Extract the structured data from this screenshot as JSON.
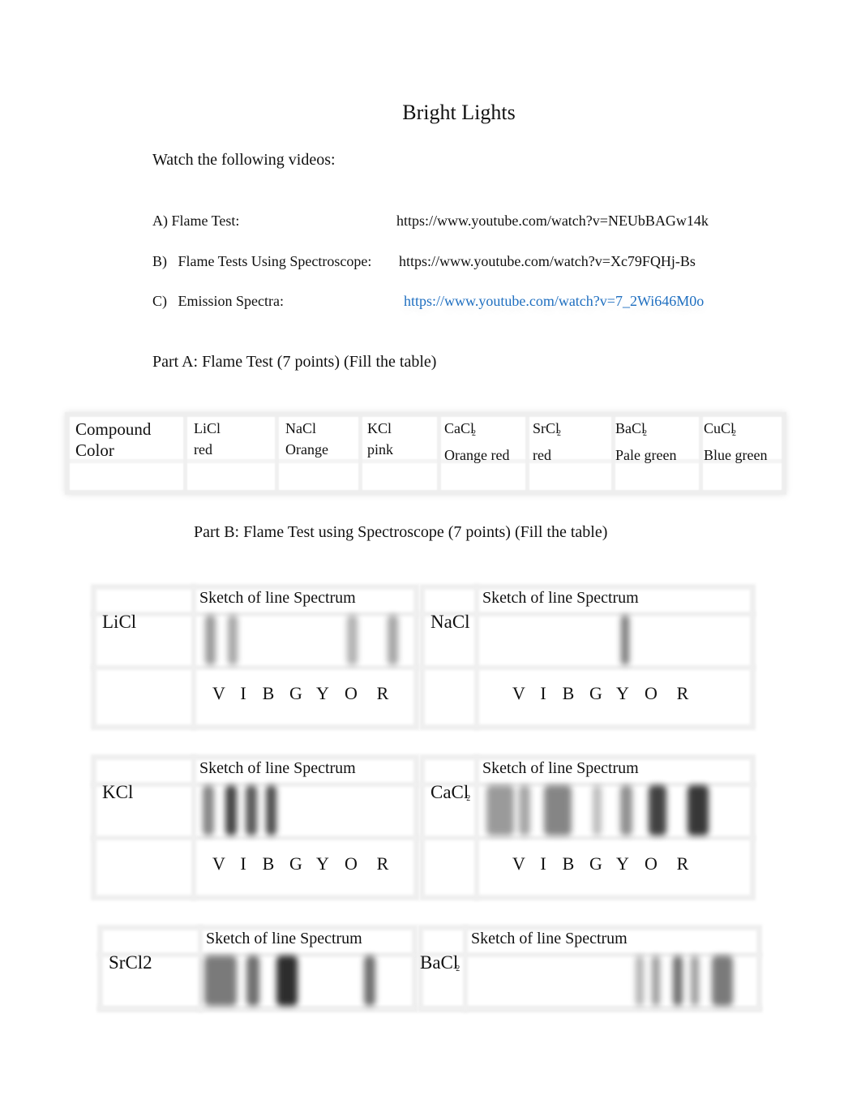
{
  "title": "Bright Lights",
  "intro": "Watch the following videos:",
  "videos": [
    {
      "label": "A) Flame Test:",
      "url": "https://www.youtube.com/watch?v=NEUbBAGw14k",
      "is_link": false
    },
    {
      "label": "B)   Flame Tests Using Spectroscope:",
      "url": "https://www.youtube.com/watch?v=Xc79FQHj-Bs",
      "is_link": false
    },
    {
      "label": "C)   Emission Spectra:",
      "url": "https://www.youtube.com/watch?v=7_2Wi646M0o",
      "is_link": true
    }
  ],
  "link_color": "#1f6fc0",
  "part_a": {
    "heading": "Part A: Flame Test (7 points) (Fill the table)",
    "header_cell": [
      "Compound",
      "Color"
    ],
    "columns": [
      {
        "compound": "LiCl",
        "sub": "",
        "color": "red"
      },
      {
        "compound": "NaCl",
        "sub": "",
        "color": "Orange"
      },
      {
        "compound": "KCl",
        "sub": "",
        "color": "pink"
      },
      {
        "compound": "CaCl",
        "sub": "2",
        "color": "Orange red"
      },
      {
        "compound": "SrCl",
        "sub": "2",
        "color": "red"
      },
      {
        "compound": "BaCl",
        "sub": "2",
        "color": "Pale green"
      },
      {
        "compound": "CuCl",
        "sub": "2",
        "color": "Blue green"
      }
    ]
  },
  "part_b": {
    "heading": "Part B:  Flame Test using Spectroscope (7 points) (Fill the table)",
    "sketch_label": "Sketch of line Spectrum",
    "scale_letters": [
      "V",
      "I",
      "B",
      "G",
      "Y",
      "O",
      "R"
    ],
    "spectra": [
      {
        "compound": "LiCl",
        "sub": "",
        "show_scale": true,
        "bands": [
          {
            "pos": 0.02,
            "width": 0.05,
            "darkness": 0.45
          },
          {
            "pos": 0.13,
            "width": 0.05,
            "darkness": 0.4
          },
          {
            "pos": 0.72,
            "width": 0.05,
            "darkness": 0.35
          },
          {
            "pos": 0.92,
            "width": 0.05,
            "darkness": 0.4
          }
        ]
      },
      {
        "compound": "NaCl",
        "sub": "",
        "show_scale": true,
        "bands": [
          {
            "pos": 0.6,
            "width": 0.05,
            "darkness": 0.6
          }
        ]
      },
      {
        "compound": "KCl",
        "sub": "",
        "show_scale": true,
        "bands": [
          {
            "pos": 0.0,
            "width": 0.09,
            "darkness": 0.55
          },
          {
            "pos": 0.18,
            "width": 0.09,
            "darkness": 0.85
          },
          {
            "pos": 0.34,
            "width": 0.09,
            "darkness": 0.75
          },
          {
            "pos": 0.5,
            "width": 0.09,
            "darkness": 0.8
          }
        ]
      },
      {
        "compound": "CaCl",
        "sub": "2",
        "show_scale": true,
        "bands": [
          {
            "pos": 0.0,
            "width": 0.12,
            "darkness": 0.45
          },
          {
            "pos": 0.14,
            "width": 0.05,
            "darkness": 0.4
          },
          {
            "pos": 0.25,
            "width": 0.12,
            "darkness": 0.55
          },
          {
            "pos": 0.46,
            "width": 0.04,
            "darkness": 0.3
          },
          {
            "pos": 0.58,
            "width": 0.05,
            "darkness": 0.5
          },
          {
            "pos": 0.7,
            "width": 0.08,
            "darkness": 0.85
          },
          {
            "pos": 0.87,
            "width": 0.09,
            "darkness": 0.9
          }
        ]
      },
      {
        "compound": "SrCl2",
        "sub": "",
        "show_scale": false,
        "bands": [
          {
            "pos": 0.0,
            "width": 0.17,
            "darkness": 0.6
          },
          {
            "pos": 0.22,
            "width": 0.07,
            "darkness": 0.65
          },
          {
            "pos": 0.38,
            "width": 0.11,
            "darkness": 0.95
          },
          {
            "pos": 0.84,
            "width": 0.06,
            "darkness": 0.65
          }
        ]
      },
      {
        "compound": "BaCl",
        "sub": "2",
        "show_scale": false,
        "bands": [
          {
            "pos": 0.43,
            "width": 0.05,
            "darkness": 0.35
          },
          {
            "pos": 0.53,
            "width": 0.05,
            "darkness": 0.45
          },
          {
            "pos": 0.66,
            "width": 0.06,
            "darkness": 0.65
          },
          {
            "pos": 0.77,
            "width": 0.05,
            "darkness": 0.45
          },
          {
            "pos": 0.9,
            "width": 0.13,
            "darkness": 0.6
          }
        ]
      }
    ]
  }
}
